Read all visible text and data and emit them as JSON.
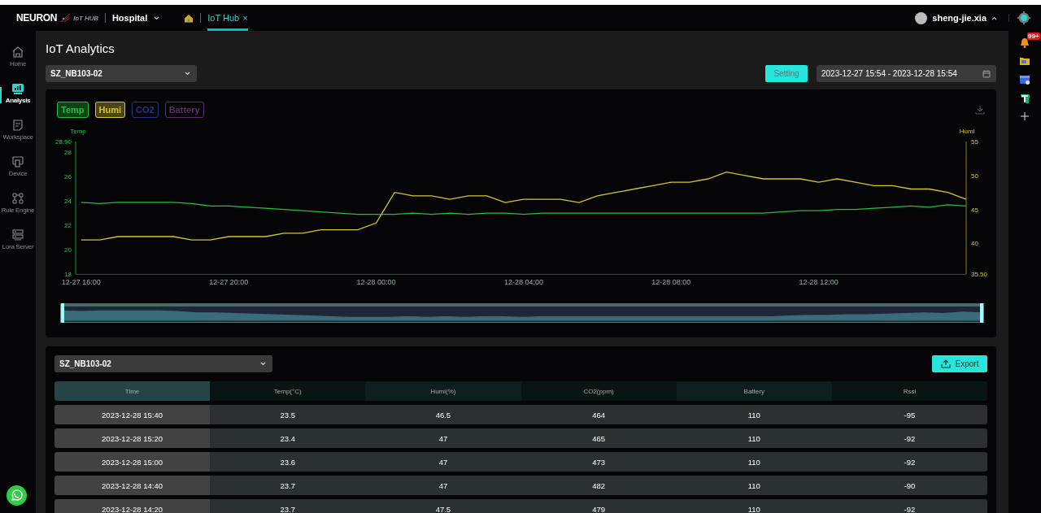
{
  "topbar": {
    "logo": "NEURON",
    "logo_sub": "IoT HUB",
    "site": "Hospital",
    "tabs": [
      {
        "label": "IoT Hub",
        "close": "×",
        "selected": true
      }
    ],
    "user": "sheng-jie.xia"
  },
  "sidebar": {
    "items": [
      {
        "label": "Home",
        "selected": false
      },
      {
        "label": "Analysis",
        "selected": true
      },
      {
        "label": "Workspace",
        "selected": false
      },
      {
        "label": "Device",
        "selected": false
      },
      {
        "label": "Rule Engine",
        "selected": false
      },
      {
        "label": "Lora Server",
        "selected": false
      }
    ]
  },
  "right_rail": {
    "badge": "99+"
  },
  "page": {
    "title": "IoT Analytics",
    "device": "SZ_NB103-02",
    "setting": "Setting",
    "date_range": "2023-12-27 15:54 - 2023-12-28 15:54"
  },
  "chart": {
    "overview": {
      "level": 1
    },
    "toggles": [
      {
        "label": "CO2",
        "color": "#2a3580",
        "on": false
      },
      {
        "label": "Battery",
        "color": "#5a2e68",
        "on": false
      }
    ],
    "chart_data": {
      "type": "line",
      "ylabel": "Temp",
      "y2label": "Humi",
      "categories": [
        "12-27 16:00",
        null,
        null,
        null,
        null,
        null,
        null,
        null,
        "12-27 20:00",
        null,
        null,
        null,
        null,
        null,
        null,
        null,
        "12-28 00:00",
        null,
        null,
        null,
        null,
        null,
        null,
        null,
        "12-28 04:00",
        null,
        null,
        null,
        null,
        null,
        null,
        null,
        "12-28 08:00",
        null,
        null,
        null,
        null,
        null,
        null,
        null,
        "12-28 12:00",
        null,
        null,
        null,
        null,
        null,
        null,
        null,
        null
      ],
      "ylim": [
        18,
        28.9
      ],
      "y2lim": [
        35.5,
        55
      ],
      "yticks": [
        18,
        20,
        22,
        24,
        26,
        28,
        {
          "value": 28.9,
          "label": "28.90"
        }
      ],
      "y2ticks": [
        {
          "value": 35.5,
          "label": "35.50"
        },
        40,
        45,
        50,
        55
      ],
      "series": [
        {
          "name": "Temp",
          "color": "#22c03a",
          "values": [
            23.9,
            23.8,
            23.9,
            23.9,
            23.9,
            23.9,
            23.8,
            23.6,
            23.6,
            23.5,
            23.4,
            23.3,
            23.2,
            23.1,
            23.0,
            22.9,
            22.9,
            22.9,
            23.0,
            22.9,
            23.0,
            22.9,
            23.0,
            23.0,
            22.9,
            23.0,
            23.0,
            23.0,
            23.0,
            23.0,
            23.0,
            23.0,
            23.0,
            23.0,
            23.0,
            23.0,
            23.0,
            23.0,
            23.1,
            23.2,
            23.2,
            23.3,
            23.3,
            23.4,
            23.5,
            23.6,
            23.5,
            23.7,
            23.6
          ]
        },
        {
          "name": "Humi",
          "color": "#d6c626",
          "axis": "y2",
          "values": [
            40.5,
            40.5,
            41,
            41,
            41,
            41,
            40.5,
            40.5,
            41,
            41,
            41,
            41.5,
            41.5,
            42,
            42,
            42,
            43,
            47.5,
            47,
            47,
            46.5,
            47,
            47,
            46,
            46.5,
            46.5,
            46.5,
            46,
            47,
            47.5,
            48,
            48.5,
            49,
            49,
            49.5,
            50.5,
            50,
            49.5,
            49.5,
            49.5,
            49,
            49.5,
            49,
            48.5,
            48.5,
            48,
            48,
            47.5,
            46.5
          ]
        }
      ]
    }
  },
  "table": {
    "device": "SZ_NB103-02",
    "export": "Export",
    "columns": [
      "Time",
      "Temp(°C)",
      "Humi(%)",
      "CO2(ppm)",
      "Battery",
      "Rssi"
    ],
    "rows": [
      [
        "2023-12-28 15:40",
        "23.5",
        "46.5",
        "464",
        "110",
        "-95"
      ],
      [
        "2023-12-28 15:20",
        "23.4",
        "47",
        "465",
        "110",
        "-92"
      ],
      [
        "2023-12-28 15:00",
        "23.6",
        "47",
        "473",
        "110",
        "-92"
      ],
      [
        "2023-12-28 14:40",
        "23.7",
        "47",
        "482",
        "110",
        "-90"
      ],
      [
        "2023-12-28 14:20",
        "23.7",
        "47.5",
        "479",
        "110",
        "-92"
      ]
    ]
  }
}
